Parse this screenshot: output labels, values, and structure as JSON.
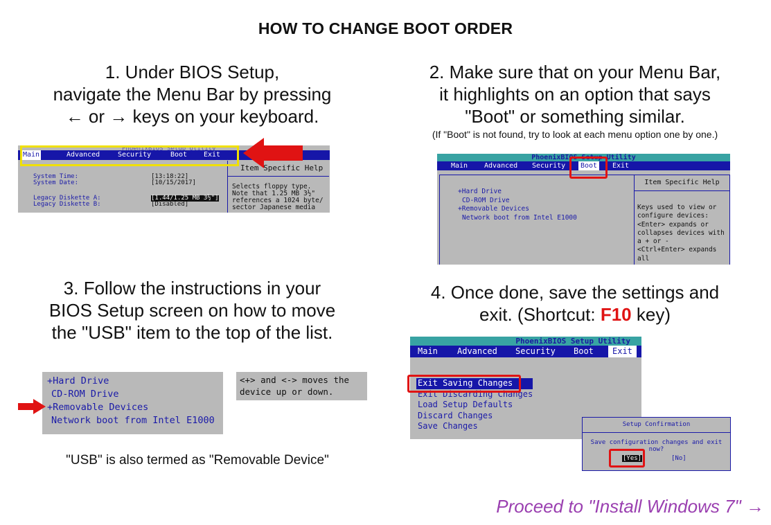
{
  "title": "HOW TO CHANGE BOOT ORDER",
  "step1": {
    "line1": "1. Under BIOS Setup,",
    "line2": "navigate the Menu Bar by pressing",
    "line3": "← or → keys on your keyboard.",
    "screen": {
      "menu": [
        "Main",
        "Advanced",
        "Security",
        "Boot",
        "Exit"
      ],
      "header_faint": "PhoenixBIOS Setup Utility",
      "help_title": "Item Specific Help",
      "rows": [
        {
          "label": "System Time:",
          "value": "[13:18:22]"
        },
        {
          "label": "System Date:",
          "value": "[10/15/2017]"
        },
        {
          "label": "Legacy Diskette A:",
          "value": "[1.44/1.25 MB  3½\"]"
        },
        {
          "label": "Legacy Diskette B:",
          "value": "[Disabled]"
        }
      ],
      "help_lines": [
        "Selects floppy type.",
        "Note that 1.25 MB 3½\"",
        "references a 1024 byte/",
        "sector Japanese media"
      ]
    }
  },
  "step2": {
    "line1": "2. Make sure that on your Menu Bar,",
    "line2": "it highlights on an option that says",
    "line3": "\"Boot\" or something similar.",
    "note": "(If \"Boot\" is not found, try to look at each menu option one by one.)",
    "screen": {
      "header": "PhoenixBIOS Setup Utility",
      "menu": [
        "Main",
        "Advanced",
        "Security",
        "Boot",
        "Exit"
      ],
      "items": [
        "+Hard Drive",
        "CD-ROM Drive",
        "+Removable Devices",
        "Network boot from Intel E1000"
      ],
      "help_title": "Item Specific Help",
      "help_lines": [
        "Keys used to view or",
        "configure devices:",
        "<Enter> expands or",
        "collapses devices with",
        "a + or -",
        "<Ctrl+Enter> expands",
        "all"
      ]
    }
  },
  "step3": {
    "line1": "3. Follow the instructions in your",
    "line2": "BIOS Setup screen on how to move",
    "line3": "the \"USB\" item to the top of the list.",
    "items": [
      "+Hard Drive",
      "CD-ROM Drive",
      "+Removable Devices",
      "Network boot from Intel E1000"
    ],
    "hint_line1": "<+> and <-> moves the",
    "hint_line2": "device up or down.",
    "note": "\"USB\" is also termed as \"Removable Device\""
  },
  "step4": {
    "line1": "4. Once done, save the settings and",
    "line2_pre": "exit. (Shortcut: ",
    "line2_key": "F10",
    "line2_post": " key)",
    "screen": {
      "header": "PhoenixBIOS Setup Utility",
      "menu": [
        "Main",
        "Advanced",
        "Security",
        "Boot",
        "Exit"
      ],
      "items": [
        "Exit Saving Changes",
        "Exit Discarding Changes",
        "Load Setup Defaults",
        "Discard Changes",
        "Save Changes"
      ],
      "dialog_title": "Setup Confirmation",
      "dialog_question": "Save configuration changes and exit now?",
      "yes": "[Yes]",
      "no": "[No]"
    }
  },
  "proceed": "Proceed to \"Install Windows 7\" →",
  "colors": {
    "accent_red": "#e01313",
    "bios_blue": "#1616a8",
    "bios_gray": "#b9b9b9",
    "link_purple": "#9a3fb0"
  }
}
